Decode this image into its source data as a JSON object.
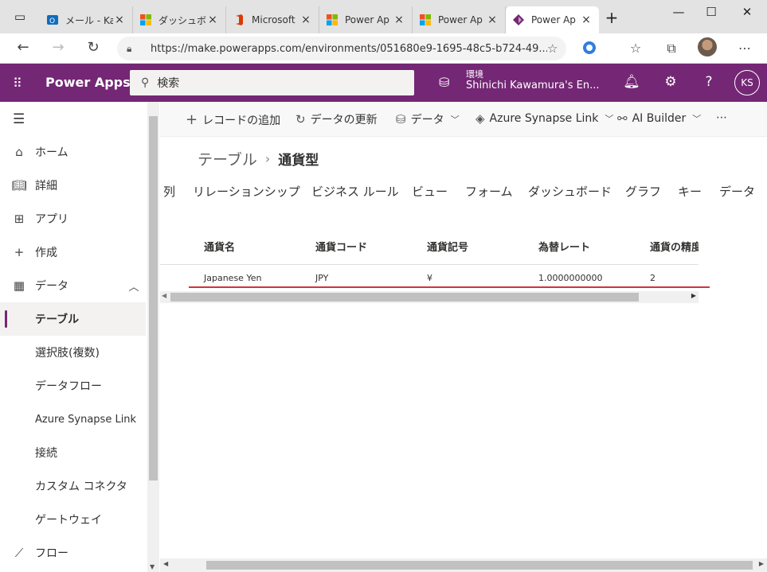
{
  "browser": {
    "tabs": [
      {
        "title": "メール - Ka",
        "icon": "outlook-icon",
        "color": "#0f6cbd"
      },
      {
        "title": "ダッシュボー",
        "icon": "microsoft-icon",
        "color": "#f25022"
      },
      {
        "title": "Microsoft",
        "icon": "office-icon",
        "color": "#d83b01"
      },
      {
        "title": "Power Ap",
        "icon": "microsoft-icon",
        "color": "#f25022"
      },
      {
        "title": "Power Ap",
        "icon": "microsoft-icon",
        "color": "#f25022"
      },
      {
        "title": "Power Ap",
        "icon": "powerapps-icon",
        "color": "#742774"
      }
    ],
    "url": "https://make.powerapps.com/environments/051680e9-1695-48c5-b724-49..."
  },
  "header": {
    "app_title": "Power Apps",
    "search_placeholder": "検索",
    "env_label": "環境",
    "env_name": "Shinichi Kawamura's En...",
    "user_initials": "KS",
    "brand_color": "#742774"
  },
  "sidebar": {
    "items": [
      {
        "label": "ホーム",
        "icon": "home-icon"
      },
      {
        "label": "詳細",
        "icon": "book-icon"
      },
      {
        "label": "アプリ",
        "icon": "apps-icon"
      },
      {
        "label": "作成",
        "icon": "plus-icon"
      },
      {
        "label": "データ",
        "icon": "table-icon"
      }
    ],
    "sub_items": [
      "テーブル",
      "選択肢(複数)",
      "データフロー",
      "Azure Synapse Link",
      "接続",
      "カスタム コネクタ",
      "ゲートウェイ"
    ],
    "flow_label": "フロー",
    "selected": "テーブル"
  },
  "commands": {
    "add_record": "レコードの追加",
    "refresh": "データの更新",
    "data": "データ",
    "synapse": "Azure Synapse Link",
    "ai_builder": "AI Builder",
    "more": "⋯"
  },
  "breadcrumb": {
    "parent": "テーブル",
    "current": "通貨型"
  },
  "tabs": [
    "列",
    "リレーションシップ",
    "ビジネス ルール",
    "ビュー",
    "フォーム",
    "ダッシュボード",
    "グラフ",
    "キー",
    "データ"
  ],
  "active_tab": "データ",
  "grid": {
    "columns": [
      "通貨名",
      "通貨コード",
      "通貨記号",
      "為替レート",
      "通貨の精度"
    ],
    "rows": [
      [
        "Japanese Yen",
        "JPY",
        "¥",
        "1.0000000000",
        "2"
      ]
    ]
  }
}
